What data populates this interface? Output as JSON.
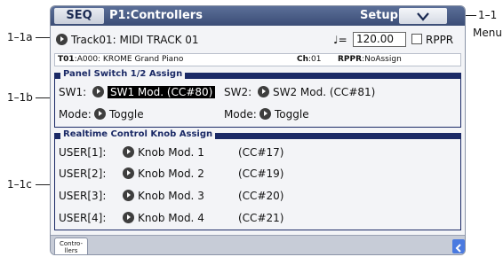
{
  "titlebar": {
    "mode_button": "SEQ",
    "page_title": "P1:Controllers",
    "setup_label": "Setup"
  },
  "track_row": {
    "track_name": "Track01: MIDI TRACK 01",
    "tempo_symbol": "♩=",
    "tempo_value": "120.00",
    "rppr_label": "RPPR"
  },
  "info_bar": {
    "track_id": "T01",
    "program": ":A000: KROME Grand Piano",
    "channel_label": "Ch",
    "channel_value": ":01",
    "rppr_label": "RPPR",
    "rppr_value": ":NoAssign"
  },
  "panel_switch": {
    "title": "Panel Switch 1/2 Assign",
    "sw1_label": "SW1:",
    "sw1_value": "SW1 Mod. (CC#80)",
    "sw2_label": "SW2:",
    "sw2_value": "SW2 Mod. (CC#81)",
    "mode1_label": "Mode:",
    "mode1_value": "Toggle",
    "mode2_label": "Mode:",
    "mode2_value": "Toggle"
  },
  "knob_assign": {
    "title": "Realtime Control Knob Assign",
    "rows": [
      {
        "label": "USER[1]:",
        "value": "Knob Mod. 1",
        "cc": "(CC#17)"
      },
      {
        "label": "USER[2]:",
        "value": "Knob Mod. 2",
        "cc": "(CC#19)"
      },
      {
        "label": "USER[3]:",
        "value": "Knob Mod. 3",
        "cc": "(CC#20)"
      },
      {
        "label": "USER[4]:",
        "value": "Knob Mod. 4",
        "cc": "(CC#21)"
      }
    ]
  },
  "bottom_bar": {
    "tab_line1": "Contro-",
    "tab_line2": "llers"
  },
  "callouts": {
    "c_1_1a": "1–1a",
    "c_1_1b": "1–1b",
    "c_1_1c": "1–1c",
    "c_1_1": "1–1",
    "menu": "Menu"
  },
  "icons": {
    "menu": "chevron-down-icon",
    "scroll": "chevron-left-icon",
    "bullet": "popup-arrow-icon"
  },
  "colors": {
    "titlebar": "#3b4d76",
    "section": "#1b2a66",
    "highlight": "#000000",
    "scroll_button": "#4a7ae0"
  }
}
